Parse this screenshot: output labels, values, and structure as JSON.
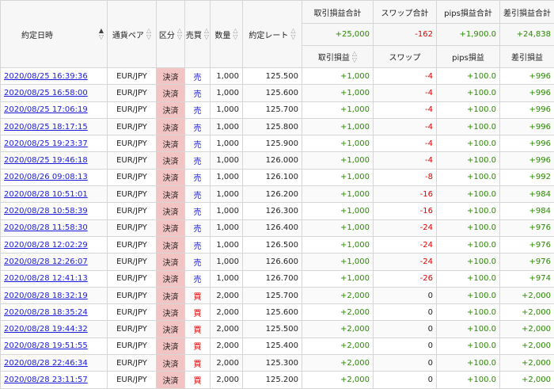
{
  "header": {
    "date": "約定日時",
    "pair": "通貨ペア",
    "kubun": "区分",
    "side": "売買",
    "qty": "数量",
    "rate": "約定レート",
    "pl_total": "取引損益合計",
    "swap_total": "スワップ合計",
    "pips_total": "pips損益合計",
    "net_total": "差引損益合計",
    "pl": "取引損益",
    "swap": "スワップ",
    "pips": "pips損益",
    "net": "差引損益",
    "sort_up": "▲",
    "sort_down": "▽"
  },
  "totals": {
    "pl": "+25,000",
    "swap": "-162",
    "pips": "+1,900.0",
    "net": "+24,838"
  },
  "rows": [
    {
      "date": "2020/08/25 16:39:36",
      "pair": "EUR/JPY",
      "kubun": "決済",
      "side": "売",
      "side_type": "sell",
      "qty": "1,000",
      "rate": "125.500",
      "pl": "+1,000",
      "swap": "-4",
      "pips": "+100.0",
      "net": "+996"
    },
    {
      "date": "2020/08/25 16:58:00",
      "pair": "EUR/JPY",
      "kubun": "決済",
      "side": "売",
      "side_type": "sell",
      "qty": "1,000",
      "rate": "125.600",
      "pl": "+1,000",
      "swap": "-4",
      "pips": "+100.0",
      "net": "+996"
    },
    {
      "date": "2020/08/25 17:06:19",
      "pair": "EUR/JPY",
      "kubun": "決済",
      "side": "売",
      "side_type": "sell",
      "qty": "1,000",
      "rate": "125.700",
      "pl": "+1,000",
      "swap": "-4",
      "pips": "+100.0",
      "net": "+996"
    },
    {
      "date": "2020/08/25 18:17:15",
      "pair": "EUR/JPY",
      "kubun": "決済",
      "side": "売",
      "side_type": "sell",
      "qty": "1,000",
      "rate": "125.800",
      "pl": "+1,000",
      "swap": "-4",
      "pips": "+100.0",
      "net": "+996"
    },
    {
      "date": "2020/08/25 19:23:37",
      "pair": "EUR/JPY",
      "kubun": "決済",
      "side": "売",
      "side_type": "sell",
      "qty": "1,000",
      "rate": "125.900",
      "pl": "+1,000",
      "swap": "-4",
      "pips": "+100.0",
      "net": "+996"
    },
    {
      "date": "2020/08/25 19:46:18",
      "pair": "EUR/JPY",
      "kubun": "決済",
      "side": "売",
      "side_type": "sell",
      "qty": "1,000",
      "rate": "126.000",
      "pl": "+1,000",
      "swap": "-4",
      "pips": "+100.0",
      "net": "+996"
    },
    {
      "date": "2020/08/26 09:08:13",
      "pair": "EUR/JPY",
      "kubun": "決済",
      "side": "売",
      "side_type": "sell",
      "qty": "1,000",
      "rate": "126.100",
      "pl": "+1,000",
      "swap": "-8",
      "pips": "+100.0",
      "net": "+992"
    },
    {
      "date": "2020/08/28 10:51:01",
      "pair": "EUR/JPY",
      "kubun": "決済",
      "side": "売",
      "side_type": "sell",
      "qty": "1,000",
      "rate": "126.200",
      "pl": "+1,000",
      "swap": "-16",
      "pips": "+100.0",
      "net": "+984"
    },
    {
      "date": "2020/08/28 10:58:39",
      "pair": "EUR/JPY",
      "kubun": "決済",
      "side": "売",
      "side_type": "sell",
      "qty": "1,000",
      "rate": "126.300",
      "pl": "+1,000",
      "swap": "-16",
      "pips": "+100.0",
      "net": "+984"
    },
    {
      "date": "2020/08/28 11:58:30",
      "pair": "EUR/JPY",
      "kubun": "決済",
      "side": "売",
      "side_type": "sell",
      "qty": "1,000",
      "rate": "126.400",
      "pl": "+1,000",
      "swap": "-24",
      "pips": "+100.0",
      "net": "+976"
    },
    {
      "date": "2020/08/28 12:02:29",
      "pair": "EUR/JPY",
      "kubun": "決済",
      "side": "売",
      "side_type": "sell",
      "qty": "1,000",
      "rate": "126.500",
      "pl": "+1,000",
      "swap": "-24",
      "pips": "+100.0",
      "net": "+976"
    },
    {
      "date": "2020/08/28 12:26:07",
      "pair": "EUR/JPY",
      "kubun": "決済",
      "side": "売",
      "side_type": "sell",
      "qty": "1,000",
      "rate": "126.600",
      "pl": "+1,000",
      "swap": "-24",
      "pips": "+100.0",
      "net": "+976"
    },
    {
      "date": "2020/08/28 12:41:13",
      "pair": "EUR/JPY",
      "kubun": "決済",
      "side": "売",
      "side_type": "sell",
      "qty": "1,000",
      "rate": "126.700",
      "pl": "+1,000",
      "swap": "-26",
      "pips": "+100.0",
      "net": "+974"
    },
    {
      "date": "2020/08/28 18:32:19",
      "pair": "EUR/JPY",
      "kubun": "決済",
      "side": "買",
      "side_type": "buy",
      "qty": "2,000",
      "rate": "125.700",
      "pl": "+2,000",
      "swap": "0",
      "pips": "+100.0",
      "net": "+2,000"
    },
    {
      "date": "2020/08/28 18:35:24",
      "pair": "EUR/JPY",
      "kubun": "決済",
      "side": "買",
      "side_type": "buy",
      "qty": "2,000",
      "rate": "125.600",
      "pl": "+2,000",
      "swap": "0",
      "pips": "+100.0",
      "net": "+2,000"
    },
    {
      "date": "2020/08/28 19:44:32",
      "pair": "EUR/JPY",
      "kubun": "決済",
      "side": "買",
      "side_type": "buy",
      "qty": "2,000",
      "rate": "125.500",
      "pl": "+2,000",
      "swap": "0",
      "pips": "+100.0",
      "net": "+2,000"
    },
    {
      "date": "2020/08/28 19:51:55",
      "pair": "EUR/JPY",
      "kubun": "決済",
      "side": "買",
      "side_type": "buy",
      "qty": "2,000",
      "rate": "125.400",
      "pl": "+2,000",
      "swap": "0",
      "pips": "+100.0",
      "net": "+2,000"
    },
    {
      "date": "2020/08/28 22:46:34",
      "pair": "EUR/JPY",
      "kubun": "決済",
      "side": "買",
      "side_type": "buy",
      "qty": "2,000",
      "rate": "125.300",
      "pl": "+2,000",
      "swap": "0",
      "pips": "+100.0",
      "net": "+2,000"
    },
    {
      "date": "2020/08/28 23:11:57",
      "pair": "EUR/JPY",
      "kubun": "決済",
      "side": "買",
      "side_type": "buy",
      "qty": "2,000",
      "rate": "125.200",
      "pl": "+2,000",
      "swap": "0",
      "pips": "+100.0",
      "net": "+2,000"
    }
  ],
  "colors": {
    "sell": "#1a1adb",
    "buy": "#e00000",
    "positive": "#2a8a00",
    "negative": "#e00000",
    "kubun_bg": "#f2c4c4",
    "link": "#1a1adb"
  }
}
